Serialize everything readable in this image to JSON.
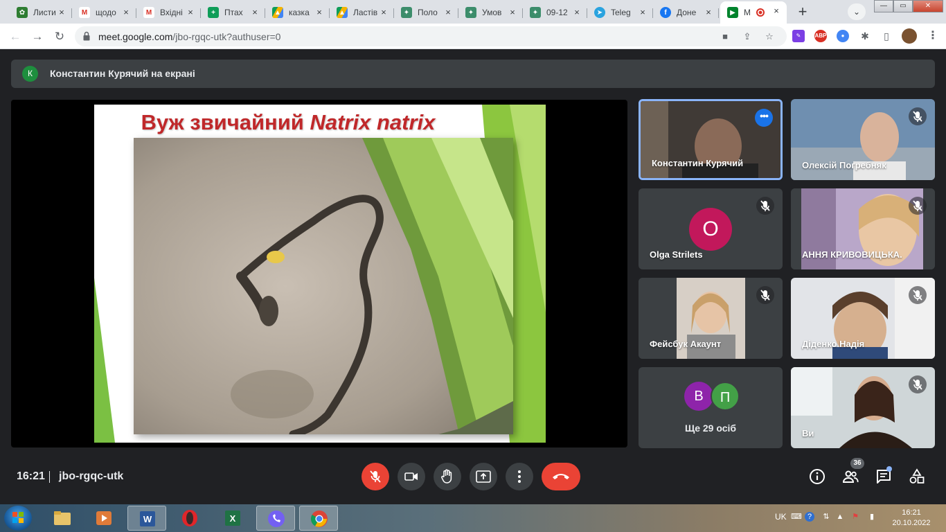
{
  "browser": {
    "tabs": [
      {
        "title": "Листи",
        "favicon": "leaf-icon",
        "color": "#2e7d32"
      },
      {
        "title": "щодо",
        "favicon": "gmail-icon",
        "color": "#d93025"
      },
      {
        "title": "Вхідні",
        "favicon": "gmail-icon",
        "color": "#d93025"
      },
      {
        "title": "Птах",
        "favicon": "sheets-icon",
        "color": "#0f9d58"
      },
      {
        "title": "казка",
        "favicon": "drive-icon",
        "color": "#f4b400"
      },
      {
        "title": "Ластів",
        "favicon": "drive-icon",
        "color": "#f4b400"
      },
      {
        "title": "Поло",
        "favicon": "ua-emblem-icon",
        "color": "#3c8d6b"
      },
      {
        "title": "Умов",
        "favicon": "ua-emblem-icon",
        "color": "#3c8d6b"
      },
      {
        "title": "09-12",
        "favicon": "ua-emblem-icon",
        "color": "#3c8d6b"
      },
      {
        "title": "Teleg",
        "favicon": "telegram-icon",
        "color": "#2aa3df"
      },
      {
        "title": "Доне",
        "favicon": "facebook-icon",
        "color": "#1877f2"
      },
      {
        "title": "M",
        "favicon": "meet-icon",
        "color": "#00832d"
      }
    ],
    "url_host": "meet.google.com",
    "url_path": "/jbo-rgqc-utk?authuser=0"
  },
  "meet": {
    "presenter_initial": "К",
    "presenter_text": "Константин Курячий на екрані",
    "slide": {
      "title_common": "Вуж звичайний",
      "title_latin": "Natrix natrix"
    },
    "participants": [
      {
        "name": "Константин Курячий",
        "speaking": true
      },
      {
        "name": "Олексій Погребняк",
        "muted": true
      },
      {
        "name": "Olga Strilets",
        "initial": "O",
        "avatar_color": "#c2185b",
        "muted": true
      },
      {
        "name": "АННЯ КРИВОВИЦЬКА.",
        "muted": true
      },
      {
        "name": "Фейсбук Акаунт",
        "muted": true
      },
      {
        "name": "Діденко Надія",
        "muted": true
      },
      {
        "name": "Ще 29 осіб",
        "initials": [
          "В",
          "П"
        ],
        "avatar_colors": [
          "#8e24aa",
          "#43a047"
        ]
      },
      {
        "name": "Ви",
        "muted": true
      }
    ],
    "clock": "16:21",
    "meeting_code": "jbo-rgqc-utk",
    "people_count": "36"
  },
  "taskbar": {
    "language": "UK",
    "time": "16:21",
    "date": "20.10.2022"
  }
}
